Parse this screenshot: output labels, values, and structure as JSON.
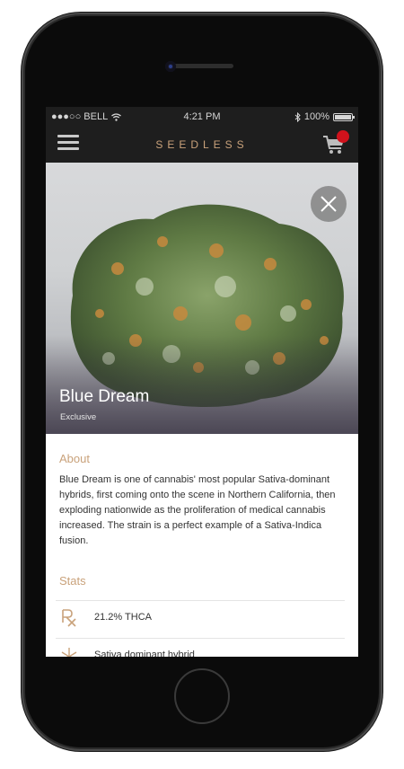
{
  "status_bar": {
    "carrier": "●●●○○ BELL",
    "time": "4:21 PM",
    "battery": "100%"
  },
  "navbar": {
    "brand": "SEEDLESS",
    "cart_badge_color": "#d1121c"
  },
  "product": {
    "name": "Blue Dream",
    "tag": "Exclusive"
  },
  "about": {
    "title": "About",
    "text": "Blue Dream is one of cannabis' most popular Sativa-dominant hybrids, first coming onto the scene in Northern California, then exploding nationwide as the proliferation of medical cannabis increased. The strain is a perfect example of a Sativa-Indica fusion."
  },
  "stats": {
    "title": "Stats",
    "items": [
      {
        "icon": "rx-icon",
        "label": "21.2% THCA"
      },
      {
        "icon": "cannabis-leaf-icon",
        "label": "Sativa dominant hybrid"
      }
    ]
  },
  "colors": {
    "accent": "#c9a27b",
    "bar": "#1e1e1e"
  }
}
